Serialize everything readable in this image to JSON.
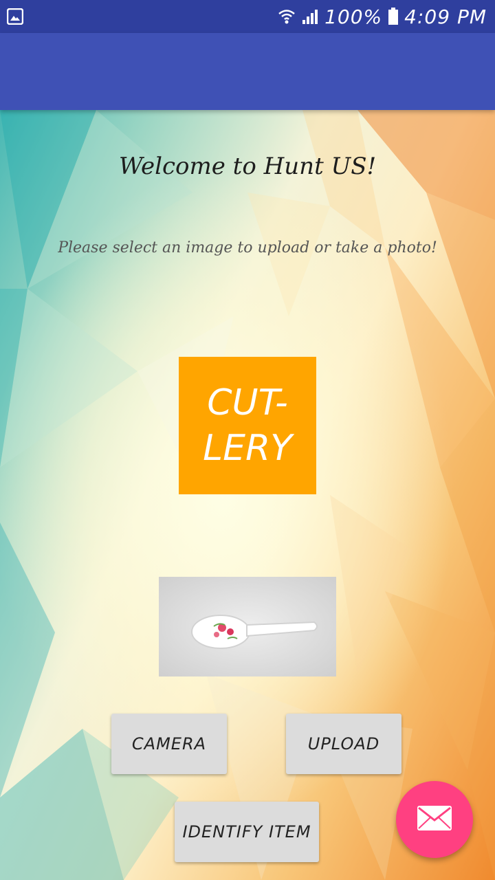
{
  "status_bar": {
    "battery": "100%",
    "time": "4:09 PM",
    "icons": [
      "gallery-icon",
      "wifi-icon",
      "signal-icon",
      "battery-icon"
    ]
  },
  "main": {
    "welcome": "Welcome to Hunt US!",
    "subtitle": "Please select an image to upload or take a photo!",
    "category_line1": "CUT-",
    "category_line2": "LERY",
    "photo_icon": "spoon-photo"
  },
  "buttons": {
    "camera": "CAMERA",
    "upload": "UPLOAD",
    "identify": "IDENTIFY ITEM"
  },
  "fab": {
    "icon": "email-icon"
  },
  "colors": {
    "status_bar": "#2f3f9e",
    "app_bar": "#3f51b5",
    "category_tile": "#ffa500",
    "button": "#dcdcdc",
    "fab": "#ff4081"
  }
}
